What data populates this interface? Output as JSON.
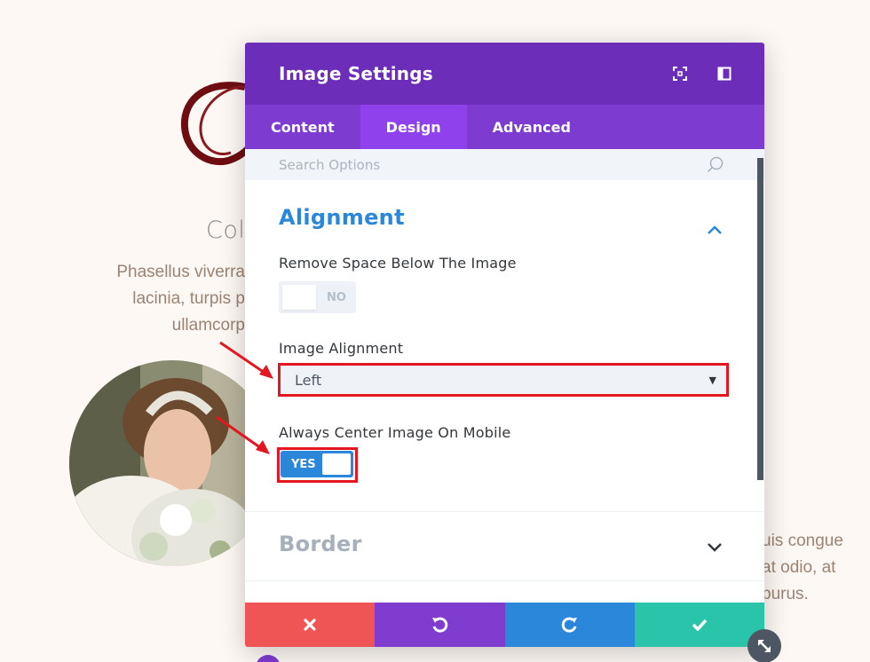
{
  "background": {
    "heading": "Col",
    "para_left": [
      "Phasellus viverra",
      "lacinia, turpis p",
      "ullamcorp"
    ],
    "para_right": [
      "uis congue",
      "at odio, at",
      "purus."
    ]
  },
  "modal": {
    "title": "Image Settings",
    "header_icons": [
      "fullscreen-icon",
      "split-view-icon"
    ],
    "tabs": [
      {
        "label": "Content",
        "active": false
      },
      {
        "label": "Design",
        "active": true
      },
      {
        "label": "Advanced",
        "active": false
      }
    ],
    "search": {
      "placeholder": "Search Options",
      "value": ""
    },
    "sections": {
      "alignment": {
        "title": "Alignment",
        "expanded": true,
        "fields": {
          "remove_space": {
            "label": "Remove Space Below The Image",
            "state": "NO"
          },
          "image_alignment": {
            "label": "Image Alignment",
            "value": "Left"
          },
          "center_mobile": {
            "label": "Always Center Image On Mobile",
            "state": "YES"
          }
        }
      },
      "border": {
        "title": "Border",
        "expanded": false
      }
    },
    "footer_icons": [
      "close-icon",
      "undo-icon",
      "redo-icon",
      "check-icon"
    ]
  },
  "colors": {
    "header": "#6c2eb9",
    "tabs": "#7d3bcf",
    "tab_active": "#8f42ec",
    "accent_blue": "#2b87da",
    "highlight_red": "#e4161f",
    "cancel": "#ef5555",
    "undo": "#7f3ccf",
    "redo": "#2b87da",
    "save": "#29c4a9"
  }
}
